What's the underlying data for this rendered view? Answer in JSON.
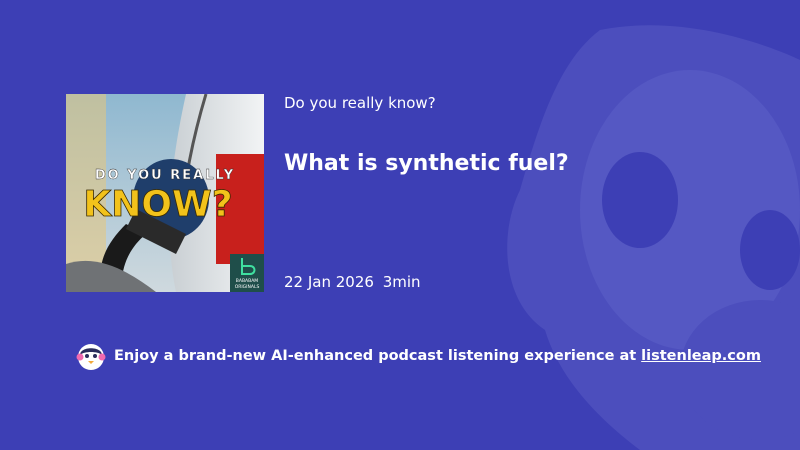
{
  "colors": {
    "background": "#3d3fb5",
    "mascot_overlay": "#5a5cc4",
    "text": "#ffffff",
    "cover_accent_yellow": "#f2c21b",
    "cover_red": "#c8201c"
  },
  "episode": {
    "show_name": "Do you really know?",
    "title": "What is synthetic fuel?",
    "date": "22 Jan 2026",
    "duration": "3min"
  },
  "cover": {
    "top_text": "DO YOU REALLY",
    "big_text": "KNOW?",
    "badge_line1": "BABABAM",
    "badge_line2": "ORIGINALS",
    "badge_icon": "bababam-b-icon"
  },
  "promo": {
    "icon": "listenleap-mascot-icon",
    "text": "Enjoy a brand-new AI-enhanced podcast listening experience at",
    "link_text": "listenleap.com"
  }
}
